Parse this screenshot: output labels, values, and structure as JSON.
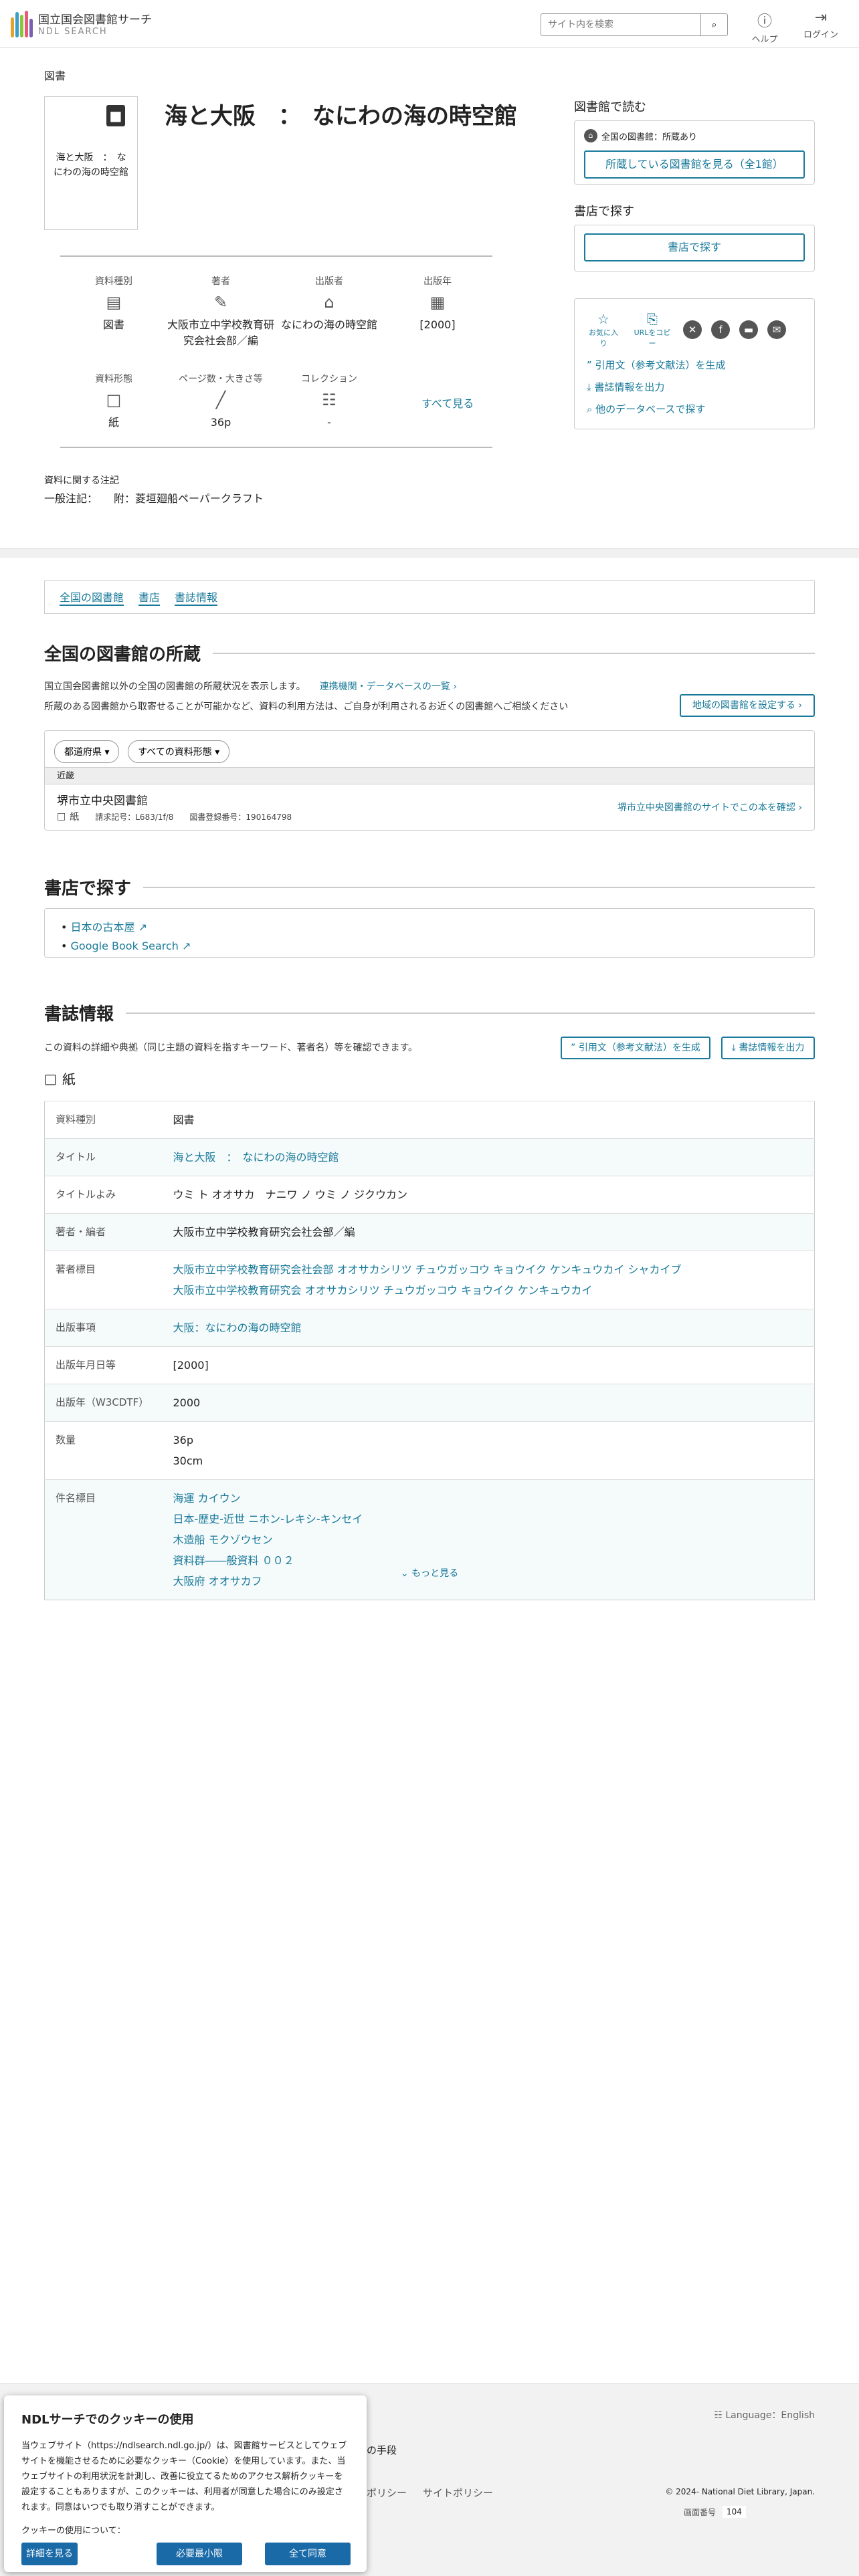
{
  "header": {
    "logo_title": "国立国会図書館サーチ",
    "logo_sub": "NDL SEARCH",
    "search_placeholder": "サイト内を検索",
    "help": "ヘルプ",
    "login": "ログイン"
  },
  "breadcrumb": "図書",
  "item": {
    "thumb_title": "海と大阪　：　なにわの海の時空館",
    "title": "海と大阪　：　なにわの海の時空館"
  },
  "meta": [
    {
      "label": "資料種別",
      "icon": "book-type-icon",
      "value": "図書"
    },
    {
      "label": "著者",
      "icon": "pen-icon",
      "value": "大阪市立中学校教育研究会社会部／編"
    },
    {
      "label": "出版者",
      "icon": "building-icon",
      "value": "なにわの海の時空館"
    },
    {
      "label": "出版年",
      "icon": "calendar-icon",
      "value": "[2000]"
    },
    {
      "label": "資料形態",
      "icon": "paper-icon",
      "value": "紙"
    },
    {
      "label": "ページ数・大きさ等",
      "icon": "ruler-icon",
      "value": "36p"
    },
    {
      "label": "コレクション",
      "icon": "open-book-icon",
      "value": "-"
    }
  ],
  "see_all": "すべて見る",
  "notes": {
    "heading": "資料に関する注記",
    "text": "一般注記：　　附：菱垣廻船ペーパークラフト"
  },
  "read": {
    "heading": "図書館で読む",
    "status": "全国の図書館：所蔵あり",
    "button": "所蔵している図書館を見る（全1館）"
  },
  "shop_side": {
    "heading": "書店で探す",
    "button": "書店で探す"
  },
  "share": {
    "favorite": "お気に入り",
    "copy_url": "URLをコピー",
    "cite": "引用文（参考文献法）を生成",
    "export": "書誌情報を出力",
    "other_db": "他のデータベースで探す"
  },
  "tabs": [
    "全国の図書館",
    "書店",
    "書誌情報"
  ],
  "holdings": {
    "heading": "全国の図書館の所蔵",
    "desc1": "国立国会図書館以外の全国の図書館の所蔵状況を表示します。",
    "link": "連携機関・データベースの一覧",
    "desc2": "所蔵のある図書館から取寄せることが可能かなど、資料の利用方法は、ご自身が利用されるお近くの図書館へご相談ください",
    "region_button": "地域の図書館を設定する",
    "filter_pref": "都道府県",
    "filter_type": "すべての資料形態",
    "region": "近畿",
    "library": "堺市立中央図書館",
    "format": "紙",
    "call_no": "請求記号：L683/1f/8　　図書登録番号：190164798",
    "site_link": "堺市立中央図書館のサイトでこの本を確認"
  },
  "shops": {
    "heading": "書店で探す",
    "items": [
      "日本の古本屋",
      "Google Book Search"
    ]
  },
  "bib": {
    "heading": "書誌情報",
    "desc": "この資料の詳細や典拠（同じ主題の資料を指すキーワード、著者名）等を確認できます。",
    "cite_btn": "引用文（参考文献法）を生成",
    "export_btn": "書誌情報を出力",
    "format": "紙",
    "rows": [
      {
        "k": "資料種別",
        "v": [
          "図書"
        ]
      },
      {
        "k": "タイトル",
        "v": [
          "海と大阪　：　なにわの海の時空館"
        ]
      },
      {
        "k": "タイトルよみ",
        "v": [
          "ウミ ト オオサカ　ナニワ ノ ウミ ノ ジクウカン"
        ]
      },
      {
        "k": "著者・編者",
        "v": [
          "大阪市立中学校教育研究会社会部／編"
        ]
      },
      {
        "k": "著者標目",
        "v": [
          "大阪市立中学校教育研究会社会部 オオサカシリツ チュウガッコウ キョウイク ケンキュウカイ シャカイブ",
          "大阪市立中学校教育研究会 オオサカシリツ チュウガッコウ キョウイク ケンキュウカイ"
        ]
      },
      {
        "k": "出版事項",
        "v": [
          "大阪：なにわの海の時空館"
        ]
      },
      {
        "k": "出版年月日等",
        "v": [
          "[2000]"
        ]
      },
      {
        "k": "出版年（W3CDTF）",
        "v": [
          "2000"
        ]
      },
      {
        "k": "数量",
        "v": [
          "36p",
          "30cm"
        ]
      },
      {
        "k": "件名標目",
        "v": [
          "海運 カイウン",
          "日本-歴史-近世 ニホン-レキシ-キンセイ",
          "木造船 モクゾウセン",
          "資料群――般資料 ００２",
          "大阪府 オオサカフ"
        ]
      }
    ],
    "more": "もっと見る"
  },
  "footer": {
    "language": "Language：English",
    "links": [
      "の手段",
      "ポリシー",
      "サイトポリシー"
    ],
    "copyright": "© 2024- National Diet Library, Japan.",
    "screen_no_label": "画面番号",
    "screen_no": "104"
  },
  "cookie": {
    "title": "NDLサーチでのクッキーの使用",
    "body": "当ウェブサイト（https://ndlsearch.ndl.go.jp/）は、図書館サービスとしてウェブサイトを機能させるために必要なクッキー（Cookie）を使用しています。また、当ウェブサイトの利用状況を計測し、改善に役立てるためのアクセス解析クッキーを設定することもありますが、このクッキーは、利用者が同意した場合にのみ設定されます。同意はいつでも取り消すことができます。",
    "usage": "クッキーの使用について：",
    "details": "詳細を見る",
    "necessary": "必要最小限",
    "accept": "全て同意"
  }
}
